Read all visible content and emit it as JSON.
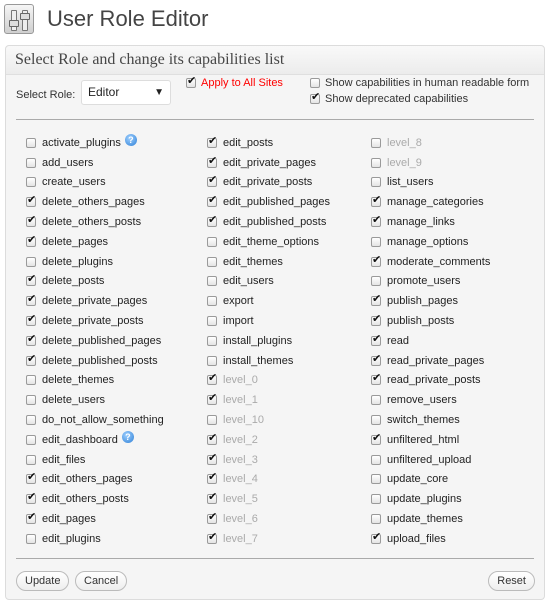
{
  "header": {
    "title": "User Role Editor",
    "icon": "sliders-icon"
  },
  "panel": {
    "title": "Select Role and change its capabilities list"
  },
  "controls": {
    "select_role_label": "Select Role:",
    "select_role_value": "Editor",
    "apply_all_sites": {
      "label": "Apply to All Sites",
      "checked": true,
      "color": "#ff0000"
    },
    "human_readable": {
      "label": "Show capabilities in human readable form",
      "checked": false
    },
    "show_deprecated": {
      "label": "Show deprecated capabilities",
      "checked": true
    }
  },
  "columns": [
    [
      {
        "name": "activate_plugins",
        "checked": false,
        "help": true
      },
      {
        "name": "add_users",
        "checked": false
      },
      {
        "name": "create_users",
        "checked": false
      },
      {
        "name": "delete_others_pages",
        "checked": true
      },
      {
        "name": "delete_others_posts",
        "checked": true
      },
      {
        "name": "delete_pages",
        "checked": true
      },
      {
        "name": "delete_plugins",
        "checked": false
      },
      {
        "name": "delete_posts",
        "checked": true
      },
      {
        "name": "delete_private_pages",
        "checked": true
      },
      {
        "name": "delete_private_posts",
        "checked": true
      },
      {
        "name": "delete_published_pages",
        "checked": true
      },
      {
        "name": "delete_published_posts",
        "checked": true
      },
      {
        "name": "delete_themes",
        "checked": false
      },
      {
        "name": "delete_users",
        "checked": false
      },
      {
        "name": "do_not_allow_something",
        "checked": false
      },
      {
        "name": "edit_dashboard",
        "checked": false,
        "help": true
      },
      {
        "name": "edit_files",
        "checked": false
      },
      {
        "name": "edit_others_pages",
        "checked": true
      },
      {
        "name": "edit_others_posts",
        "checked": true
      },
      {
        "name": "edit_pages",
        "checked": true
      },
      {
        "name": "edit_plugins",
        "checked": false
      }
    ],
    [
      {
        "name": "edit_posts",
        "checked": true
      },
      {
        "name": "edit_private_pages",
        "checked": true
      },
      {
        "name": "edit_private_posts",
        "checked": true
      },
      {
        "name": "edit_published_pages",
        "checked": true
      },
      {
        "name": "edit_published_posts",
        "checked": true
      },
      {
        "name": "edit_theme_options",
        "checked": false
      },
      {
        "name": "edit_themes",
        "checked": false
      },
      {
        "name": "edit_users",
        "checked": false
      },
      {
        "name": "export",
        "checked": false
      },
      {
        "name": "import",
        "checked": false
      },
      {
        "name": "install_plugins",
        "checked": false
      },
      {
        "name": "install_themes",
        "checked": false
      },
      {
        "name": "level_0",
        "checked": true,
        "deprecated": true
      },
      {
        "name": "level_1",
        "checked": true,
        "deprecated": true
      },
      {
        "name": "level_10",
        "checked": false,
        "deprecated": true
      },
      {
        "name": "level_2",
        "checked": true,
        "deprecated": true
      },
      {
        "name": "level_3",
        "checked": true,
        "deprecated": true
      },
      {
        "name": "level_4",
        "checked": true,
        "deprecated": true
      },
      {
        "name": "level_5",
        "checked": true,
        "deprecated": true
      },
      {
        "name": "level_6",
        "checked": true,
        "deprecated": true
      },
      {
        "name": "level_7",
        "checked": true,
        "deprecated": true
      }
    ],
    [
      {
        "name": "level_8",
        "checked": false,
        "deprecated": true
      },
      {
        "name": "level_9",
        "checked": false,
        "deprecated": true
      },
      {
        "name": "list_users",
        "checked": false
      },
      {
        "name": "manage_categories",
        "checked": true
      },
      {
        "name": "manage_links",
        "checked": true
      },
      {
        "name": "manage_options",
        "checked": false
      },
      {
        "name": "moderate_comments",
        "checked": true
      },
      {
        "name": "promote_users",
        "checked": false
      },
      {
        "name": "publish_pages",
        "checked": true
      },
      {
        "name": "publish_posts",
        "checked": true
      },
      {
        "name": "read",
        "checked": true
      },
      {
        "name": "read_private_pages",
        "checked": true
      },
      {
        "name": "read_private_posts",
        "checked": true
      },
      {
        "name": "remove_users",
        "checked": false
      },
      {
        "name": "switch_themes",
        "checked": false
      },
      {
        "name": "unfiltered_html",
        "checked": true
      },
      {
        "name": "unfiltered_upload",
        "checked": false
      },
      {
        "name": "update_core",
        "checked": false
      },
      {
        "name": "update_plugins",
        "checked": false
      },
      {
        "name": "update_themes",
        "checked": false
      },
      {
        "name": "upload_files",
        "checked": true
      }
    ]
  ],
  "buttons": {
    "update": "Update",
    "cancel": "Cancel",
    "reset": "Reset"
  }
}
